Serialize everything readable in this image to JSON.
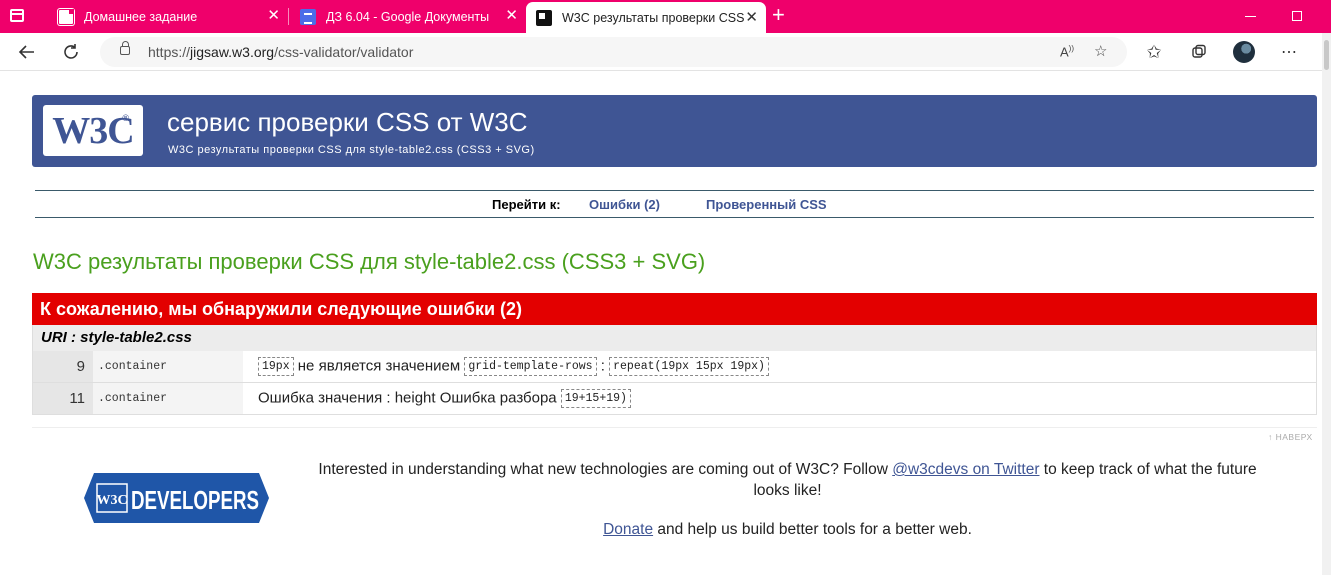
{
  "browser": {
    "tabs": [
      {
        "title": "Домашнее задание",
        "favicon": "document-icon"
      },
      {
        "title": "ДЗ 6.04 - Google Документы",
        "favicon": "google-docs-icon"
      },
      {
        "title": "W3C результаты проверки CSS",
        "favicon": "w3c-icon",
        "active": true
      }
    ],
    "url_prefix": "https://",
    "url_host": "jigsaw.w3.org",
    "url_path": "/css-validator/validator"
  },
  "banner": {
    "logo_text": "W3C",
    "logo_reg": "®",
    "title": "сервис проверки CSS от W3C",
    "subtitle": "W3C результаты проверки CSS для style-table2.css (CSS3 + SVG)"
  },
  "nav": {
    "label": "Перейти к:",
    "links": [
      "Ошибки (2)",
      "Проверенный CSS"
    ]
  },
  "results_title": "W3C результаты проверки CSS для style-table2.css (CSS3 + SVG)",
  "errors": {
    "header": "К сожалению, мы обнаружили следующие ошибки (2)",
    "uri": "URI : style-table2.css",
    "rows": [
      {
        "line": "9",
        "context": ".container",
        "code1": "19px",
        "text1": " не является значением ",
        "code2": "grid-template-rows",
        "text2": " : ",
        "code3": "repeat(19px 15px 19px)"
      },
      {
        "line": "11",
        "context": ".container",
        "text1": "Ошибка значения : height Ошибка разбора ",
        "code1": "19+15+19)"
      }
    ]
  },
  "back_to_top": "↑ НАВЕРХ",
  "footer": {
    "dev_logo_w3c": "W3C",
    "dev_logo_text": "DEVELOPERS",
    "text_before": "Interested in understanding what new technologies are coming out of W3C? Follow ",
    "twitter_link": "@w3cdevs on Twitter",
    "text_after": " to keep track of what the future looks like!",
    "donate_link": "Donate",
    "donate_after": " and help us build better tools for a better web."
  },
  "colors": {
    "tabbar": "#ef006b",
    "banner": "#3f5594",
    "error_header": "#e30000",
    "result_title": "#4aa01e"
  }
}
